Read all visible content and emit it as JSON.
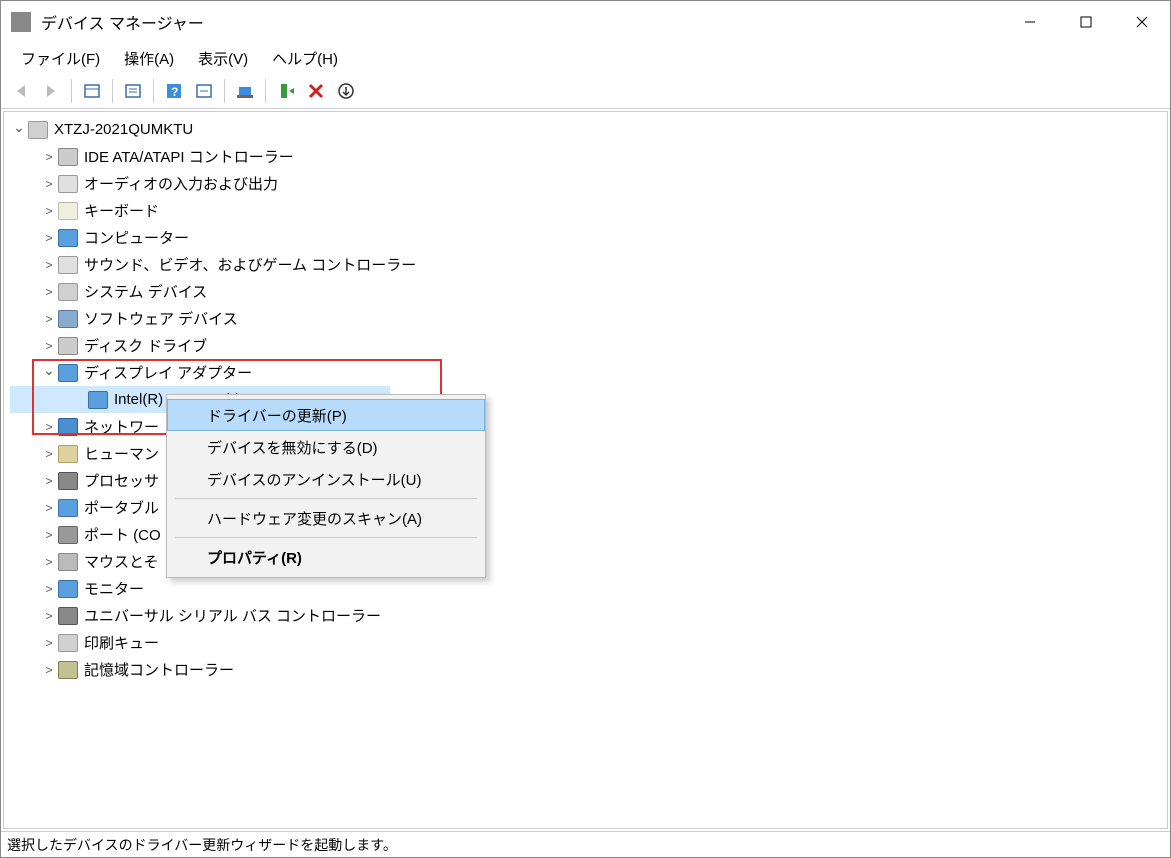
{
  "window": {
    "title": "デバイス マネージャー"
  },
  "menu": {
    "file": "ファイル(F)",
    "action": "操作(A)",
    "view": "表示(V)",
    "help": "ヘルプ(H)"
  },
  "tree": {
    "root": "XTZJ-2021QUMKTU",
    "ide": "IDE ATA/ATAPI コントローラー",
    "audio": "オーディオの入力および出力",
    "keyboard": "キーボード",
    "computer": "コンピューター",
    "sound": "サウンド、ビデオ、およびゲーム コントローラー",
    "system": "システム デバイス",
    "software": "ソフトウェア デバイス",
    "disk": "ディスク ドライブ",
    "display": "ディスプレイ アダプター",
    "display_child": "Intel(R) HD Graphics 4600",
    "network": "ネットワー",
    "hid": "ヒューマン",
    "processor": "プロセッサ",
    "portable": "ポータブル",
    "ports": "ポート (CO",
    "mouse": "マウスとそ",
    "monitor": "モニター",
    "usb": "ユニバーサル シリアル バス コントローラー",
    "printq": "印刷キュー",
    "storage": "記憶域コントローラー"
  },
  "context_menu": {
    "update_driver": "ドライバーの更新(P)",
    "disable": "デバイスを無効にする(D)",
    "uninstall": "デバイスのアンインストール(U)",
    "scan": "ハードウェア変更のスキャン(A)",
    "properties": "プロパティ(R)"
  },
  "status": "選択したデバイスのドライバー更新ウィザードを起動します。"
}
